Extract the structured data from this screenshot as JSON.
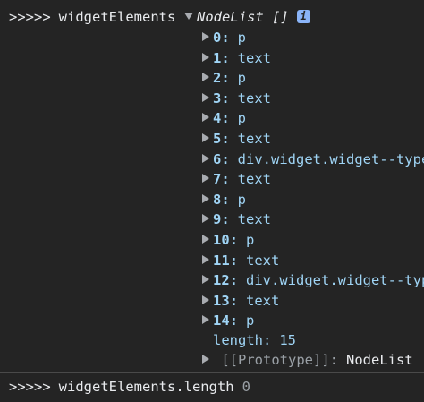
{
  "console": {
    "first_entry": {
      "prompt": ">>>>>",
      "expression": "widgetElements",
      "result_type": "NodeList []",
      "info_badge": "i"
    },
    "items": [
      {
        "key": "0:",
        "value": "p"
      },
      {
        "key": "1:",
        "value": "text"
      },
      {
        "key": "2:",
        "value": "p"
      },
      {
        "key": "3:",
        "value": "text"
      },
      {
        "key": "4:",
        "value": "p"
      },
      {
        "key": "5:",
        "value": "text"
      },
      {
        "key": "6:",
        "value": "div.widget.widget--type"
      },
      {
        "key": "7:",
        "value": "text"
      },
      {
        "key": "8:",
        "value": "p"
      },
      {
        "key": "9:",
        "value": "text"
      },
      {
        "key": "10:",
        "value": "p"
      },
      {
        "key": "11:",
        "value": "text"
      },
      {
        "key": "12:",
        "value": "div.widget.widget--typ"
      },
      {
        "key": "13:",
        "value": "text"
      },
      {
        "key": "14:",
        "value": "p"
      }
    ],
    "length_key": "length:",
    "length_value": "15",
    "prototype_key": "[[Prototype]]:",
    "prototype_value": "NodeList",
    "second_entry": {
      "prompt": ">>>>>",
      "expression": "widgetElements.length",
      "result": "0"
    }
  },
  "colors": {
    "background": "#242424",
    "key": "#9fd4f5",
    "text": "#e8eaed",
    "muted": "#9aa0a6",
    "badge": "#8ab4f8"
  },
  "icons": {
    "expanded": "triangle-down-icon",
    "collapsed": "triangle-right-icon",
    "info": "info-icon"
  }
}
